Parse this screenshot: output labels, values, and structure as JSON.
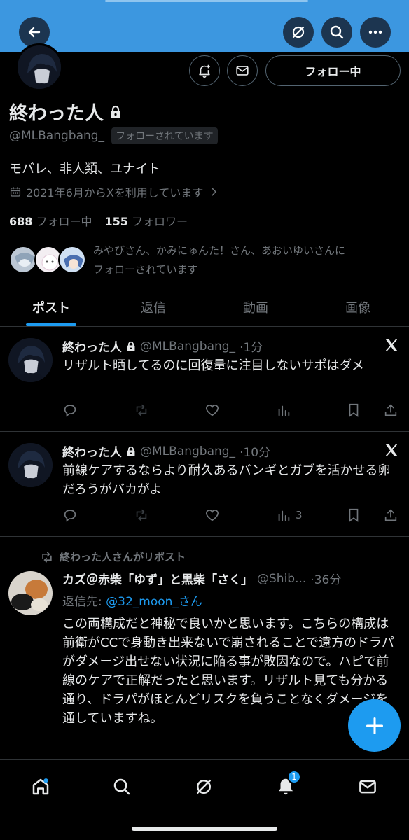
{
  "header": {
    "back_icon": "arrow-left-icon",
    "grok_icon": "grok-icon",
    "search_icon": "search-icon",
    "more_icon": "more-icon"
  },
  "profile": {
    "name": "終わった人",
    "handle": "@MLBangbang_",
    "follows_you": "フォローされています",
    "follow_button": "フォロー中",
    "bio": "モバレ、非人類、ユナイト",
    "joined": "2021年6月からXを利用しています",
    "following_count": "688",
    "following_label": "フォロー中",
    "followers_count": "155",
    "followers_label": "フォロワー",
    "mutuals_line1": "みやびさん、かみにゅんた！さん、あおいゆいさんに",
    "mutuals_line2": "フォローされています"
  },
  "tabs": [
    {
      "label": "ポスト",
      "active": true
    },
    {
      "label": "返信"
    },
    {
      "label": "動画"
    },
    {
      "label": "画像"
    }
  ],
  "posts": [
    {
      "name": "終わった人",
      "handle": "@MLBangbang_",
      "time": "·1分",
      "text": "リザルト晒してるのに回復量に注目しないサポはダメ",
      "views": ""
    },
    {
      "name": "終わった人",
      "handle": "@MLBangbang_",
      "time": "·10分",
      "text": "前線ケアするならより耐久あるバンギとガブを活かせる卵だろうがバカがよ",
      "views": "3"
    },
    {
      "reposted_by": "終わった人さんがリポスト",
      "name": "カズ＠赤柴「ゆず」と黒柴「さく」",
      "handle": "@Shib...",
      "time": "·36分",
      "reply_prefix": "返信先:",
      "reply_to": "@32_moon_さん",
      "text": "この両構成だと神秘で良いかと思います。こちらの構成は前衛がCCで身動き出来ないで崩されることで遠方のドラパがダメージ出せない状況に陥る事が敗因なので。ハピで前線のケアで正解だったと思います。リザルト見ても分かる通り、ドラパがほとんどリスクを負うことなくダメージを通していますね。"
    }
  ],
  "bottom_nav": {
    "notifications_badge": "1"
  },
  "colors": {
    "accent": "#1d9bf0",
    "banner": "#3c97e0",
    "muted": "#71767b"
  }
}
